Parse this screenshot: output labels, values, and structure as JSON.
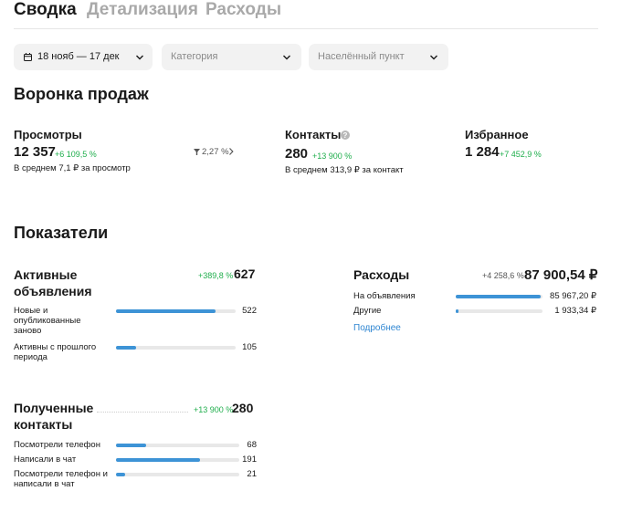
{
  "tabs": [
    {
      "label": "Сводка",
      "active": true
    },
    {
      "label": "Детализация",
      "active": false
    },
    {
      "label": "Расходы",
      "active": false
    }
  ],
  "filters": {
    "period": "18 нояб — 17 дек",
    "category_placeholder": "Категория",
    "city_placeholder": "Населённый пункт"
  },
  "funnel": {
    "title": "Воронка продаж",
    "views": {
      "title": "Просмотры",
      "value": "12 357",
      "delta": "+6 109,5 %",
      "sub": "В среднем 7,1 ₽ за просмотр",
      "conversion": "2,27 %"
    },
    "contacts": {
      "title": "Контакты",
      "value": "280",
      "delta": "+13 900 %",
      "sub": "В среднем 313,9 ₽ за контакт"
    },
    "favorites": {
      "title": "Избранное",
      "value": "1 284",
      "delta": "+7 452,9 %"
    }
  },
  "indicators": {
    "title": "Показатели",
    "active_ads": {
      "title": "Активные объявления",
      "delta": "+389,8 %",
      "total": "627",
      "rows": [
        {
          "label": "Новые и опубликованные заново",
          "value": "522",
          "fraction": 0.833
        },
        {
          "label": "Активны с прошлого периода",
          "value": "105",
          "fraction": 0.167
        }
      ]
    },
    "received_contacts": {
      "title": "Полученные контакты",
      "delta": "+13 900 %",
      "total": "280",
      "rows": [
        {
          "label": "Посмотрели телефон",
          "value": "68",
          "fraction": 0.243
        },
        {
          "label": "Написали в чат",
          "value": "191",
          "fraction": 0.682
        },
        {
          "label": "Посмотрели телефон и написали в чат",
          "value": "21",
          "fraction": 0.075
        }
      ]
    },
    "expenses": {
      "title": "Расходы",
      "delta": "+4 258,6 %",
      "total": "87 900,54 ₽",
      "rows": [
        {
          "label": "На объявления",
          "value": "85 967,20 ₽",
          "fraction": 0.978
        },
        {
          "label": "Другие",
          "value": "1 933,34 ₽",
          "fraction": 0.022
        }
      ],
      "more_link": "Подробнее"
    }
  },
  "colors": {
    "accent": "#3d93d6",
    "positive": "#1fae4c",
    "link": "#2f86d2"
  }
}
